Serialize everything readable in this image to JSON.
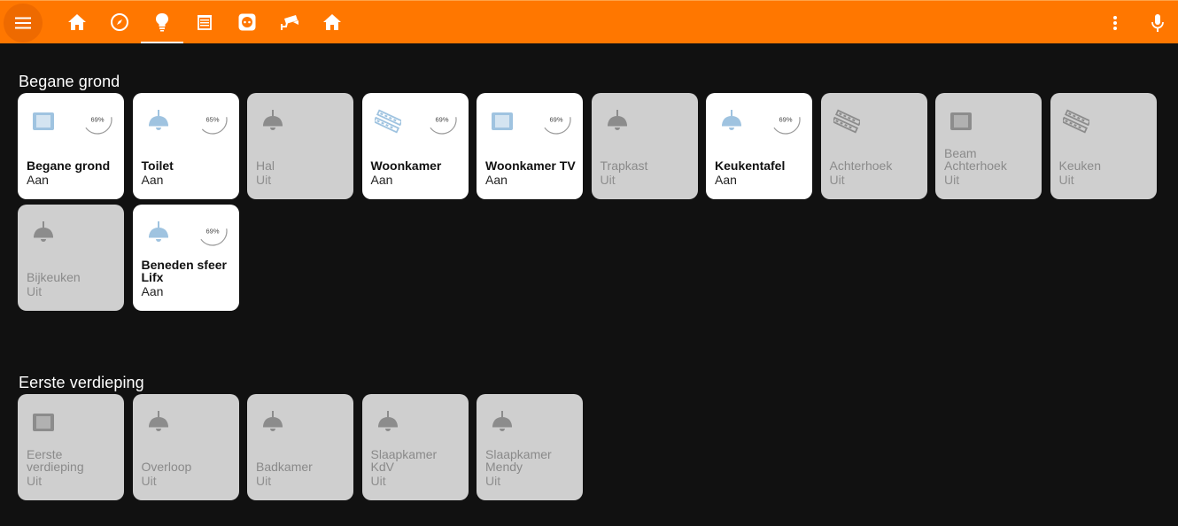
{
  "colors": {
    "accent": "#ff7700",
    "on_icon": "#9fc3e0",
    "off_icon": "#8c8c8c"
  },
  "header": {
    "tabs": [
      {
        "icon": "home-icon"
      },
      {
        "icon": "compass-icon"
      },
      {
        "icon": "lightbulb-icon",
        "active": true
      },
      {
        "icon": "blinds-icon"
      },
      {
        "icon": "power-socket-icon"
      },
      {
        "icon": "cctv-camera-icon"
      },
      {
        "icon": "home-icon"
      }
    ],
    "more_icon": "dots-vertical-icon",
    "mic_icon": "microphone-icon"
  },
  "sections": [
    {
      "title": "Begane grond",
      "tiles": [
        {
          "name": "Begane grond",
          "state": "Aan",
          "icon": "light-panel-icon",
          "on": true,
          "dial": "69%",
          "level": 0.69
        },
        {
          "name": "Toilet",
          "state": "Aan",
          "icon": "ceiling-lamp-icon",
          "on": true,
          "dial": "65%",
          "level": 0.65
        },
        {
          "name": "Hal",
          "state": "Uit",
          "icon": "ceiling-lamp-icon",
          "on": false
        },
        {
          "name": "Woonkamer",
          "state": "Aan",
          "icon": "led-strip-icon",
          "on": true,
          "dial": "69%",
          "level": 0.69
        },
        {
          "name": "Woonkamer TV",
          "state": "Aan",
          "icon": "light-panel-icon",
          "on": true,
          "dial": "69%",
          "level": 0.69
        },
        {
          "name": "Trapkast",
          "state": "Uit",
          "icon": "ceiling-lamp-icon",
          "on": false
        },
        {
          "name": "Keukentafel",
          "state": "Aan",
          "icon": "ceiling-lamp-icon",
          "on": true,
          "dial": "69%",
          "level": 0.69
        },
        {
          "name": "Achterhoek",
          "state": "Uit",
          "icon": "led-strip-icon",
          "on": false
        },
        {
          "name": "Beam Achterhoek",
          "state": "Uit",
          "icon": "light-panel-icon",
          "on": false
        },
        {
          "name": "Keuken",
          "state": "Uit",
          "icon": "led-strip-icon",
          "on": false
        },
        {
          "name": "Bijkeuken",
          "state": "Uit",
          "icon": "ceiling-lamp-icon",
          "on": false
        },
        {
          "name": "Beneden sfeer Lifx",
          "state": "Aan",
          "icon": "ceiling-lamp-icon",
          "on": true,
          "dial": "69%",
          "level": 0.69
        }
      ]
    },
    {
      "title": "Eerste verdieping",
      "tiles": [
        {
          "name": "Eerste verdieping",
          "state": "Uit",
          "icon": "light-panel-icon",
          "on": false
        },
        {
          "name": "Overloop",
          "state": "Uit",
          "icon": "ceiling-lamp-icon",
          "on": false
        },
        {
          "name": "Badkamer",
          "state": "Uit",
          "icon": "ceiling-lamp-icon",
          "on": false
        },
        {
          "name": "Slaapkamer KdV",
          "state": "Uit",
          "icon": "ceiling-lamp-icon",
          "on": false
        },
        {
          "name": "Slaapkamer Mendy",
          "state": "Uit",
          "icon": "ceiling-lamp-icon",
          "on": false
        }
      ]
    }
  ]
}
